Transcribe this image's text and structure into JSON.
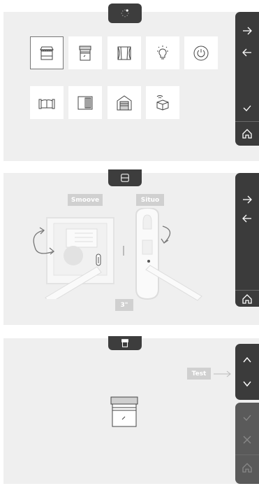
{
  "panel1": {
    "tiles": [
      {
        "name": "awning-icon",
        "selected": true
      },
      {
        "name": "roller-shutter-icon",
        "selected": false
      },
      {
        "name": "curtain-icon",
        "selected": false
      },
      {
        "name": "light-bulb-icon",
        "selected": false
      },
      {
        "name": "power-icon",
        "selected": false
      },
      {
        "name": "gate-icon",
        "selected": false
      },
      {
        "name": "sliding-gate-icon",
        "selected": false
      },
      {
        "name": "garage-door-icon",
        "selected": false
      },
      {
        "name": "wireless-box-icon",
        "selected": false
      }
    ],
    "sidebar": [
      "arrow-right-icon",
      "arrow-left-icon",
      "check-icon",
      "home-icon"
    ]
  },
  "panel2": {
    "left_device_label": "Smoove",
    "right_device_label": "Situo",
    "duration_label": "3\"",
    "separator": "|",
    "sidebar": [
      "arrow-right-icon",
      "arrow-left-icon",
      "home-icon"
    ]
  },
  "panel3": {
    "test_label": "Test",
    "sidebar": [
      "chevron-up-icon",
      "chevron-down-icon",
      "check-icon",
      "close-icon",
      "home-icon"
    ]
  }
}
